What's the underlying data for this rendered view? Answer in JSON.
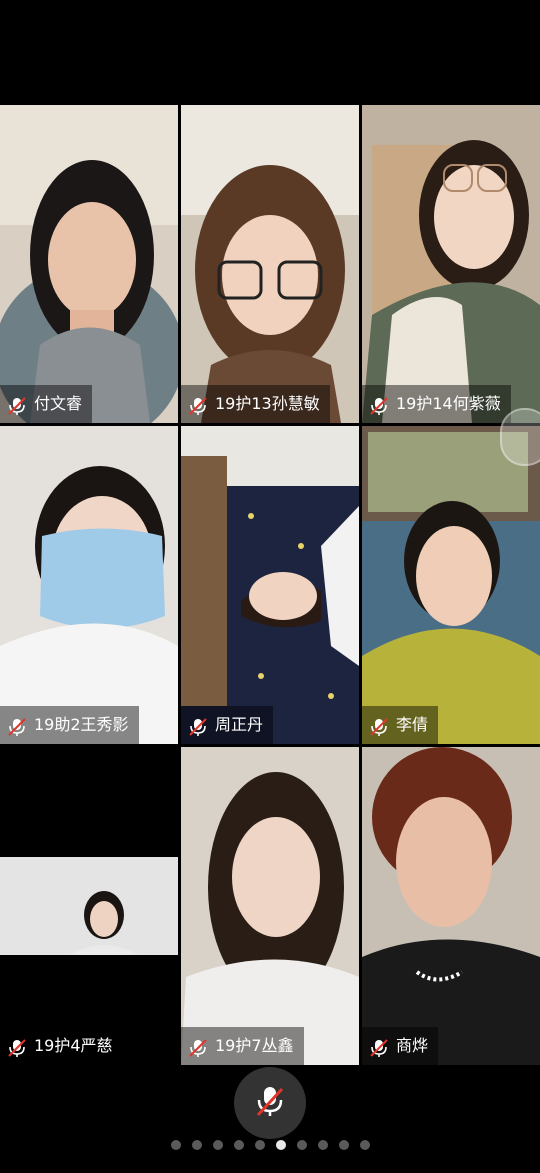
{
  "participants": [
    {
      "name": "付文睿",
      "mic": "muted"
    },
    {
      "name": "19护13孙慧敏",
      "mic": "muted"
    },
    {
      "name": "19护14何紫薇",
      "mic": "muted"
    },
    {
      "name": "19助2王秀影",
      "mic": "muted"
    },
    {
      "name": "周正丹",
      "mic": "muted"
    },
    {
      "name": "李倩",
      "mic": "muted"
    },
    {
      "name": "19护4严慈",
      "mic": "muted"
    },
    {
      "name": "19护7丛鑫",
      "mic": "muted"
    },
    {
      "name": "商烨",
      "mic": "muted"
    }
  ],
  "controls": {
    "microphone": "muted-mic-icon"
  },
  "pagination": {
    "total": 10,
    "current": 6
  },
  "colors": {
    "muted_red": "#e0352b",
    "label_bg": "rgba(0,0,0,0.45)"
  }
}
